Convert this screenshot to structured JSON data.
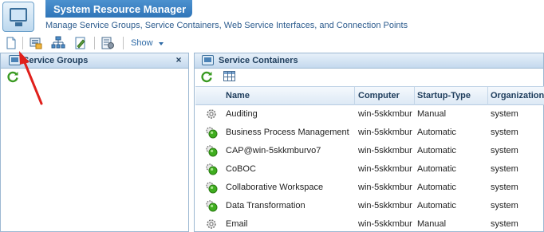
{
  "app": {
    "title": "System Resource Manager",
    "subtitle": "Manage Service Groups, Service Containers, Web Service Interfaces, and Connection Points"
  },
  "toolbar": {
    "buttons": [
      {
        "name": "new-document-icon"
      },
      {
        "name": "service-group-icon"
      },
      {
        "name": "hierarchy-icon"
      },
      {
        "name": "edit-document-icon"
      },
      {
        "name": "properties-icon"
      }
    ],
    "show_label": "Show"
  },
  "left_panel": {
    "title": "Service Groups",
    "close_label": "×"
  },
  "right_panel": {
    "title": "Service Containers",
    "columns": [
      "Name",
      "Computer",
      "Startup-Type",
      "Organization"
    ],
    "rows": [
      {
        "status": "stopped",
        "name": "Auditing",
        "computer": "win-5skkmbur",
        "startup": "Manual",
        "org": "system"
      },
      {
        "status": "running",
        "name": "Business Process Management",
        "computer": "win-5skkmbur",
        "startup": "Automatic",
        "org": "system"
      },
      {
        "status": "running",
        "name": "CAP@win-5skkmburvo7",
        "computer": "win-5skkmbur",
        "startup": "Automatic",
        "org": "system"
      },
      {
        "status": "running",
        "name": "CoBOC",
        "computer": "win-5skkmbur",
        "startup": "Automatic",
        "org": "system"
      },
      {
        "status": "running",
        "name": "Collaborative Workspace",
        "computer": "win-5skkmbur",
        "startup": "Automatic",
        "org": "system"
      },
      {
        "status": "running",
        "name": "Data Transformation",
        "computer": "win-5skkmbur",
        "startup": "Automatic",
        "org": "system"
      },
      {
        "status": "stopped",
        "name": "Email",
        "computer": "win-5skkmbur",
        "startup": "Manual",
        "org": "system"
      }
    ]
  },
  "colors": {
    "accent": "#2f75b8",
    "running": "#3fae1f",
    "annotation_arrow": "#e0201c"
  }
}
